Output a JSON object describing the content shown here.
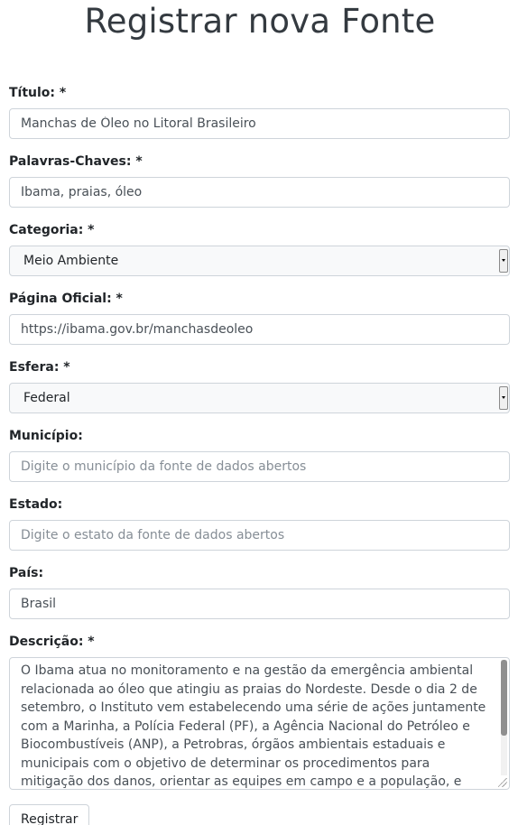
{
  "page": {
    "title": "Registrar nova Fonte"
  },
  "form": {
    "titulo": {
      "label": "Título: *",
      "value": "Manchas de Óleo no Litoral Brasileiro"
    },
    "palavras_chaves": {
      "label": "Palavras-Chaves: *",
      "value": "Ibama, praias, óleo"
    },
    "categoria": {
      "label": "Categoria: *",
      "selected": "Meio Ambiente"
    },
    "pagina_oficial": {
      "label": "Página Oficial: *",
      "value": "https://ibama.gov.br/manchasdeoleo"
    },
    "esfera": {
      "label": "Esfera: *",
      "selected": "Federal"
    },
    "municipio": {
      "label": "Município:",
      "placeholder": "Digite o município da fonte de dados abertos"
    },
    "estado": {
      "label": "Estado:",
      "placeholder": "Digite o estato da fonte de dados abertos"
    },
    "pais": {
      "label": "País:",
      "value": "Brasil"
    },
    "descricao": {
      "label": "Descrição: *",
      "value": "O Ibama atua no monitoramento e na gestão da emergência ambiental relacionada ao óleo que atingiu as praias do Nordeste. Desde o dia 2 de setembro, o Instituto vem estabelecendo uma série de ações juntamente com a Marinha, a Polícia Federal (PF), a Agência Nacional do Petróleo e Biocombustíveis (ANP), a Petrobras, órgãos ambientais estaduais e municipais com o objetivo de determinar os procedimentos para mitigação dos danos, orientar as equipes em campo e a população, e"
    },
    "submit_label": "Registrar"
  }
}
